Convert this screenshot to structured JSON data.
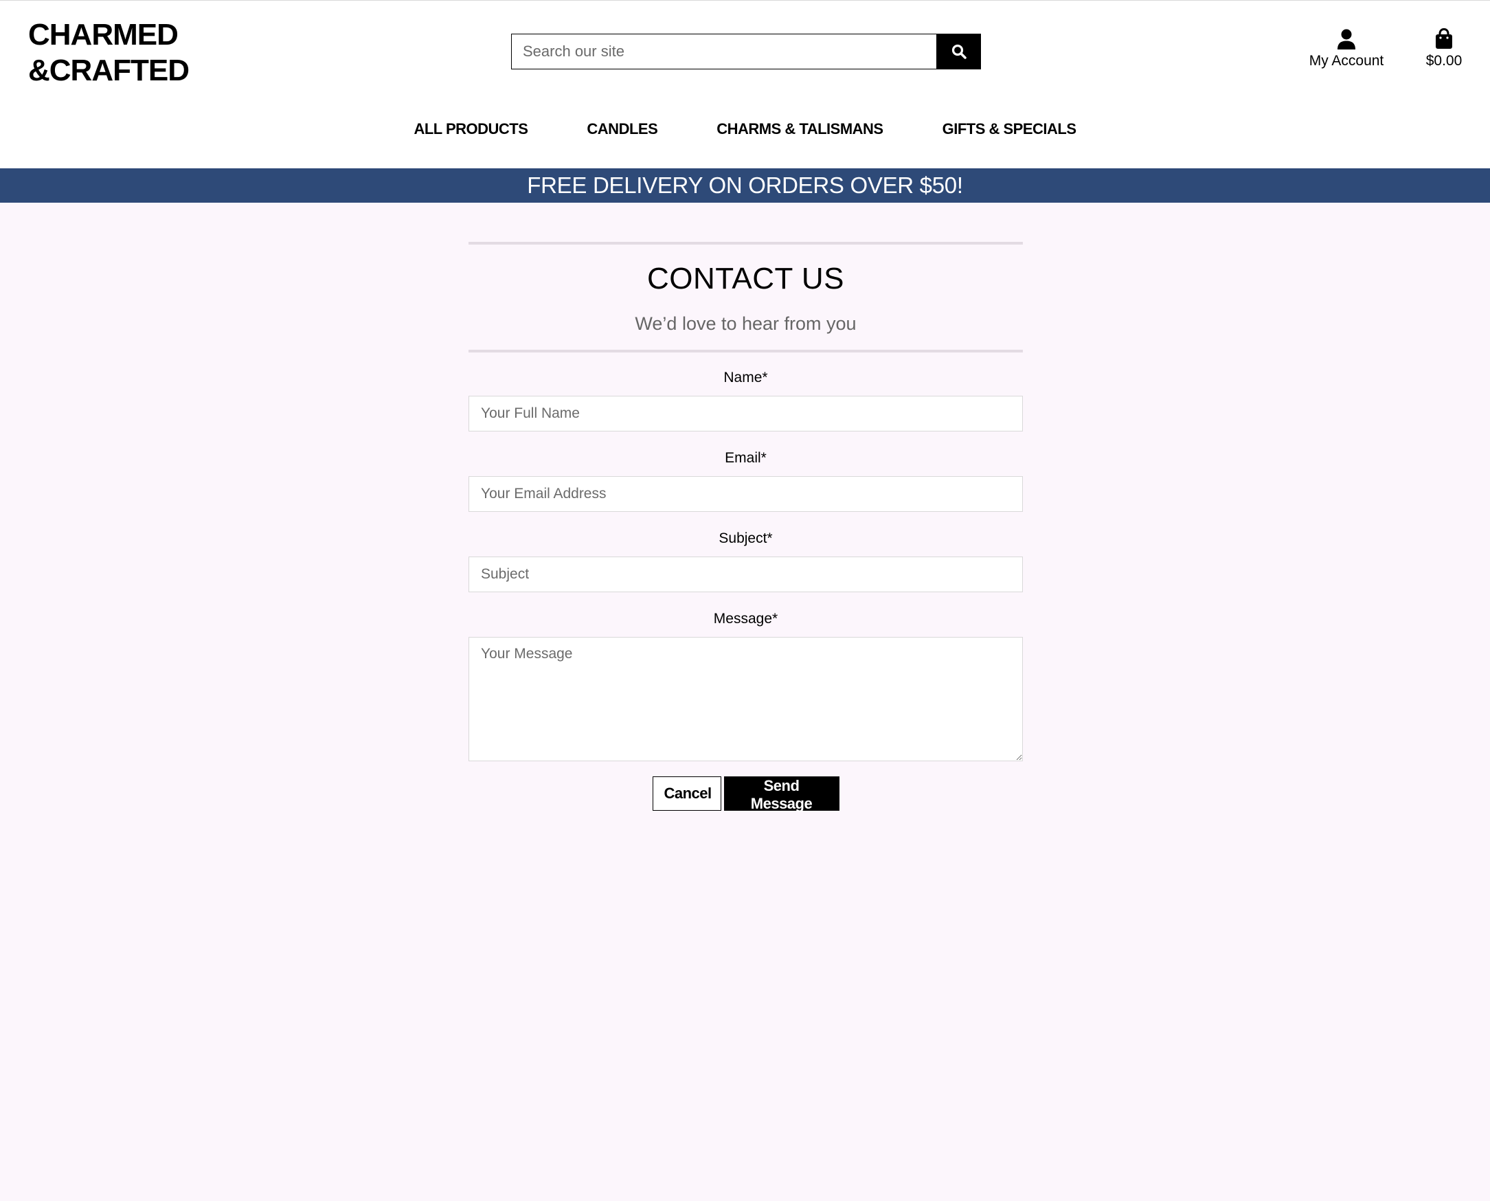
{
  "brand": {
    "line1": "CHARMED",
    "line2": "&CRAFTED"
  },
  "search": {
    "placeholder": "Search our site",
    "icon": "search-icon"
  },
  "account": {
    "label": "My Account",
    "icon": "user-icon"
  },
  "cart": {
    "total": "$0.00",
    "icon": "shopping-bag-icon"
  },
  "nav": {
    "items": [
      {
        "label": "ALL PRODUCTS"
      },
      {
        "label": "CANDLES"
      },
      {
        "label": "CHARMS & TALISMANS"
      },
      {
        "label": "GIFTS & SPECIALS"
      }
    ]
  },
  "banner": {
    "text": "FREE DELIVERY ON ORDERS OVER $50!",
    "color": "#2e4a78"
  },
  "page": {
    "title": "CONTACT US",
    "subtitle": "We’d love to hear from you"
  },
  "form": {
    "name": {
      "label": "Name*",
      "placeholder": "Your Full Name",
      "value": ""
    },
    "email": {
      "label": "Email*",
      "placeholder": "Your Email Address",
      "value": ""
    },
    "subject": {
      "label": "Subject*",
      "placeholder": "Subject",
      "value": ""
    },
    "message": {
      "label": "Message*",
      "placeholder": "Your Message",
      "value": ""
    },
    "cancel_label": "Cancel",
    "submit_label": "Send Message"
  },
  "colors": {
    "background": "#fcf6fc",
    "header": "#ffffff",
    "primary_button": "#000000"
  }
}
